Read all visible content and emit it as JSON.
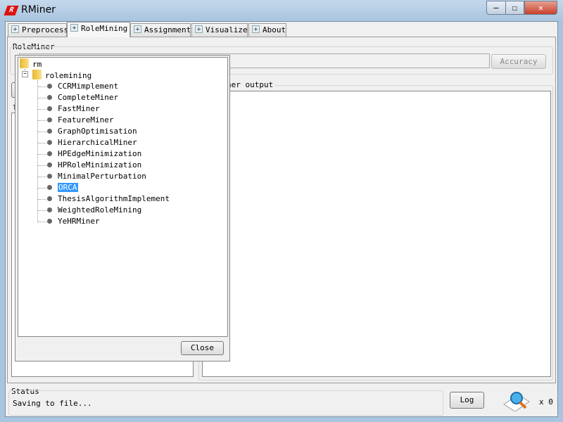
{
  "window": {
    "title": "RMiner",
    "minimize": "—",
    "maximize": "☐",
    "close": "✕"
  },
  "tabs": [
    {
      "label": "Preprocess"
    },
    {
      "label": "RoleMining",
      "active": true
    },
    {
      "label": "Assignment"
    },
    {
      "label": "Visualize"
    },
    {
      "label": "About"
    }
  ],
  "roleminer": {
    "group_label": "RoleMiner",
    "accuracy_button": "Accuracy",
    "output_title": "ner output",
    "left_label": "l"
  },
  "tree_popup": {
    "root": "rm",
    "folder": "rolemining",
    "items": [
      "CCRMimplement",
      "CompleteMiner",
      "FastMiner",
      "FeatureMiner",
      "GraphOptimisation",
      "HierarchicalMiner",
      "HPEdgeMinimization",
      "HPRoleMinimization",
      "MinimalPerturbation",
      "ORCA",
      "ThesisAlgorithmImplement",
      "WeightedRoleMining",
      "YeHRMiner"
    ],
    "selected": "ORCA",
    "close_button": "Close"
  },
  "status": {
    "label": "Status",
    "text": "Saving to file...",
    "log_button": "Log",
    "count": "x 0",
    "icon": "search-document-icon"
  }
}
